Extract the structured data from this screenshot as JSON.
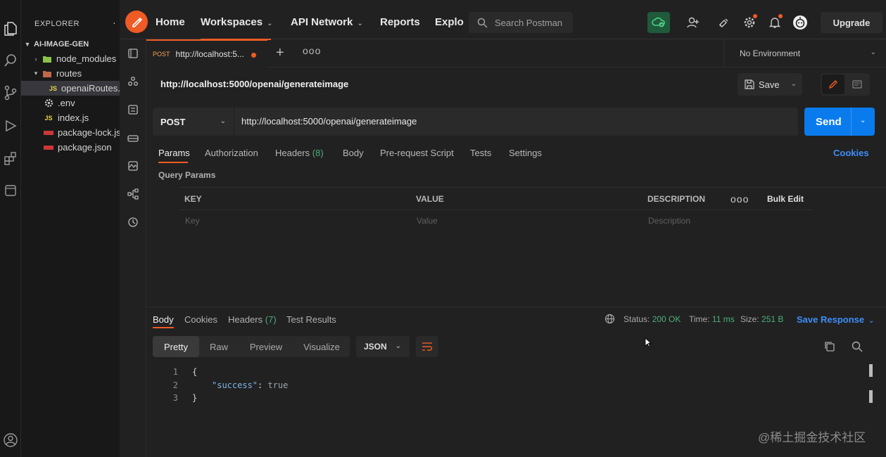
{
  "vscode": {
    "explorer_title": "EXPLORER",
    "explorer_more": "···",
    "root_folder": "AI-IMAGE-GEN",
    "tree": [
      {
        "label": "node_modules",
        "type": "folder",
        "expanded": false
      },
      {
        "label": "routes",
        "type": "folder",
        "expanded": true
      },
      {
        "label": "openaiRoutes.js",
        "type": "js",
        "selected": true
      },
      {
        "label": ".env",
        "type": "env"
      },
      {
        "label": "index.js",
        "type": "js"
      },
      {
        "label": "package-lock.json",
        "type": "json"
      },
      {
        "label": "package.json",
        "type": "json"
      }
    ],
    "js_badge": "JS"
  },
  "postman": {
    "nav": {
      "home": "Home",
      "workspaces": "Workspaces",
      "api_network": "API Network",
      "reports": "Reports",
      "explore": "Explo",
      "search_placeholder": "Search Postman",
      "upgrade": "Upgrade"
    },
    "tab": {
      "method": "POST",
      "label": "http://localhost:5...",
      "plus": "+",
      "more": "ooo"
    },
    "environment": "No Environment",
    "request": {
      "title": "http://localhost:5000/openai/generateimage",
      "save": "Save",
      "method": "POST",
      "url": "http://localhost:5000/openai/generateimage",
      "send": "Send"
    },
    "request_tabs": {
      "params": "Params",
      "authorization": "Authorization",
      "headers": "Headers",
      "headers_count": "(8)",
      "body": "Body",
      "prerequest": "Pre-request Script",
      "tests": "Tests",
      "settings": "Settings",
      "cookies": "Cookies"
    },
    "query_params": {
      "label": "Query Params",
      "columns": [
        "KEY",
        "VALUE",
        "DESCRIPTION"
      ],
      "placeholders": [
        "Key",
        "Value",
        "Description"
      ],
      "more": "ooo",
      "bulk_edit": "Bulk Edit"
    },
    "response": {
      "tabs": {
        "body": "Body",
        "cookies": "Cookies",
        "headers": "Headers",
        "headers_count": "(7)",
        "test_results": "Test Results"
      },
      "status_label": "Status:",
      "status_value": "200 OK",
      "time_label": "Time:",
      "time_value": "11 ms",
      "size_label": "Size:",
      "size_value": "251 B",
      "save_response": "Save Response",
      "formats": [
        "Pretty",
        "Raw",
        "Preview",
        "Visualize"
      ],
      "active_format": "Pretty",
      "language": "JSON",
      "code": [
        {
          "n": "1",
          "text": "{"
        },
        {
          "n": "2",
          "key": "\"success\"",
          "sep": ": ",
          "val": "true"
        },
        {
          "n": "3",
          "text": "}"
        }
      ]
    }
  },
  "watermark": "@稀土掘金技术社区",
  "colors": {
    "postman_orange": "#ef5b25",
    "send_blue": "#097bed",
    "link_blue": "#3e8ef7",
    "ok_green": "#4caf7a"
  }
}
